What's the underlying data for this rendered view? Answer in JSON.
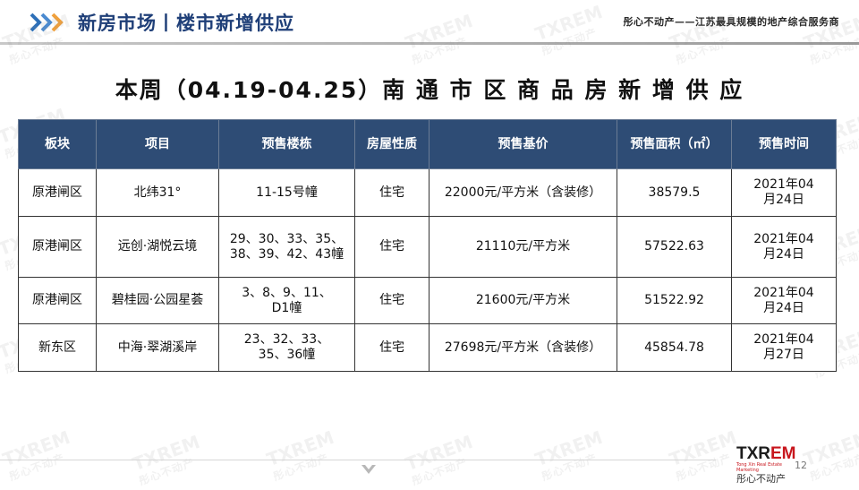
{
  "header": {
    "title": "新房市场丨楼市新增供应",
    "slogan": "彤心不动产——江苏最具规模的地产综合服务商"
  },
  "main_title": "本周（04.19-04.25）南 通 市 区 商 品 房 新 增 供 应",
  "table": {
    "headers": [
      "板块",
      "项目",
      "预售楼栋",
      "房屋性质",
      "预售基价",
      "预售面积（㎡）",
      "预售时间"
    ],
    "rows": [
      {
        "district": "原港闸区",
        "project": "北纬31°",
        "buildings": "11-15号幢",
        "type": "住宅",
        "price": "22000元/平方米（含装修）",
        "area": "38579.5",
        "date": "2021年04月24日"
      },
      {
        "district": "原港闸区",
        "project": "远创·湖悦云境",
        "buildings": "29、30、33、35、38、39、42、43幢",
        "type": "住宅",
        "price": "21110元/平方米",
        "area": "57522.63",
        "date": "2021年04月24日"
      },
      {
        "district": "原港闸区",
        "project": "碧桂园·公园星荟",
        "buildings": "3、8、9、11、D1幢",
        "type": "住宅",
        "price": "21600元/平方米",
        "area": "51522.92",
        "date": "2021年04月24日"
      },
      {
        "district": "新东区",
        "project": "中海·翠湖溪岸",
        "buildings": "23、32、33、35、36幢",
        "type": "住宅",
        "price": "27698元/平方米（含装修）",
        "area": "45854.78",
        "date": "2021年04月27日"
      }
    ]
  },
  "watermark": {
    "text": "TXREM",
    "sub": "彤心不动产"
  },
  "logo": {
    "mark_black": "TXR",
    "mark_red": "EM",
    "tagline": "Tong Xin Real Estate Marketing",
    "cn": "彤心不动产"
  },
  "page_number": "12",
  "colors": {
    "header_blue": "#1f3f78",
    "table_header": "#2e4c75",
    "brand_red": "#c8161d",
    "chevron_blue": "#2d6fb8",
    "chevron_orange": "#f0a03c"
  }
}
